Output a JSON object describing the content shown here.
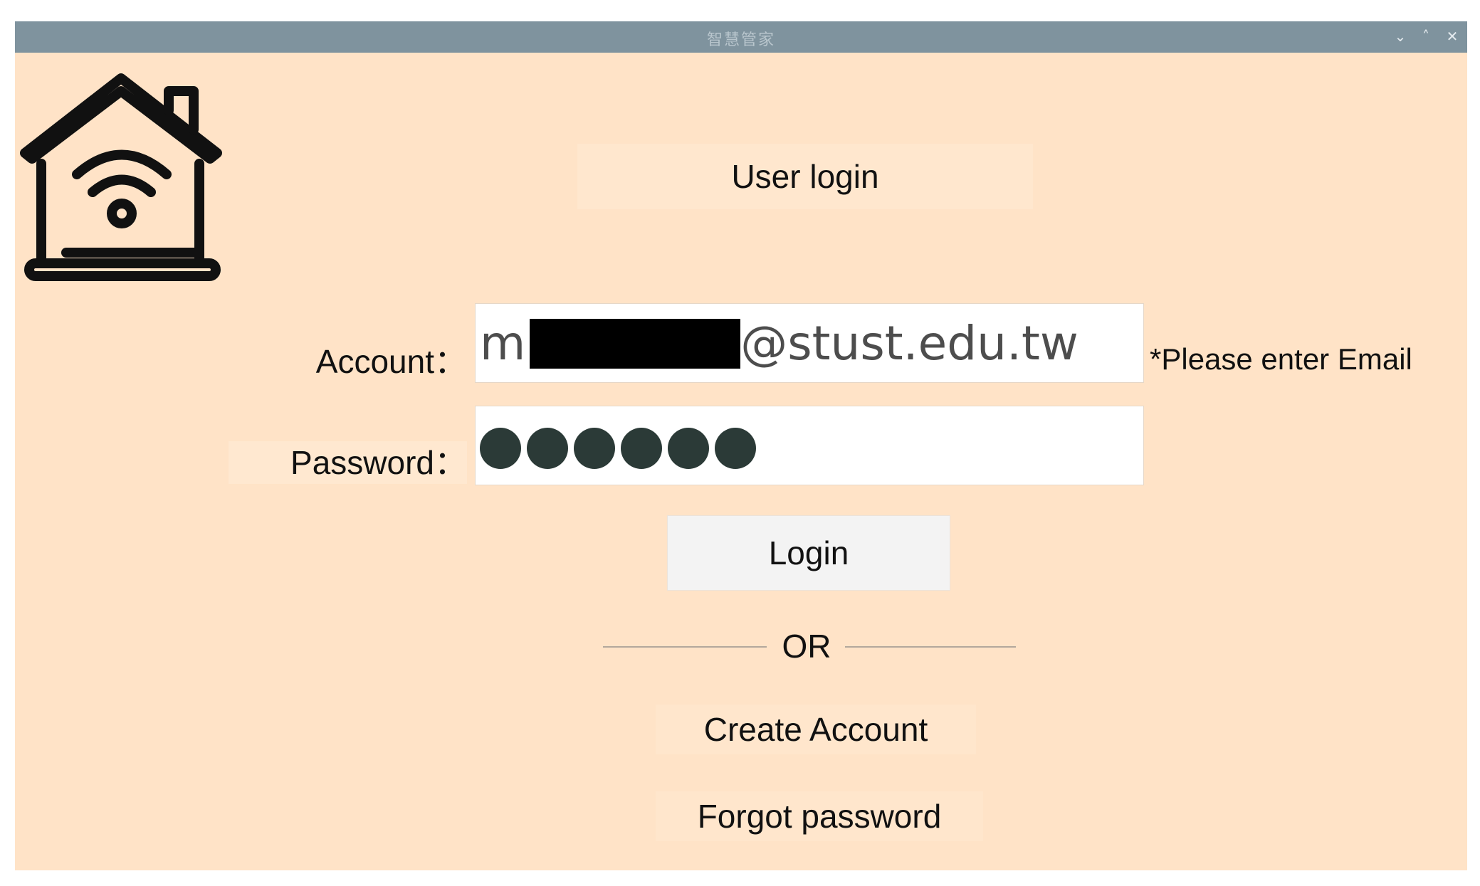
{
  "window": {
    "title": "智慧管家",
    "minimize_glyph": "⌄",
    "maximize_glyph": "˄",
    "close_glyph": "✕"
  },
  "logo": {
    "icon": "smart-home-wifi-icon"
  },
  "heading": "User login",
  "account": {
    "label": "Account",
    "separator": "：",
    "value_prefix": "m",
    "value_suffix": "@stust.edu.tw",
    "hint": "*Please enter Email"
  },
  "password": {
    "label": "Password",
    "separator": "：",
    "masked_char_count": 6
  },
  "login_button": "Login",
  "divider": "OR",
  "links": {
    "create_account": "Create Account",
    "forgot_password": "Forgot password"
  },
  "colors": {
    "background": "#ffe3c7",
    "titlebar": "#7f939e",
    "button": "#f3f3f3",
    "password_dot": "#2b3a37"
  }
}
